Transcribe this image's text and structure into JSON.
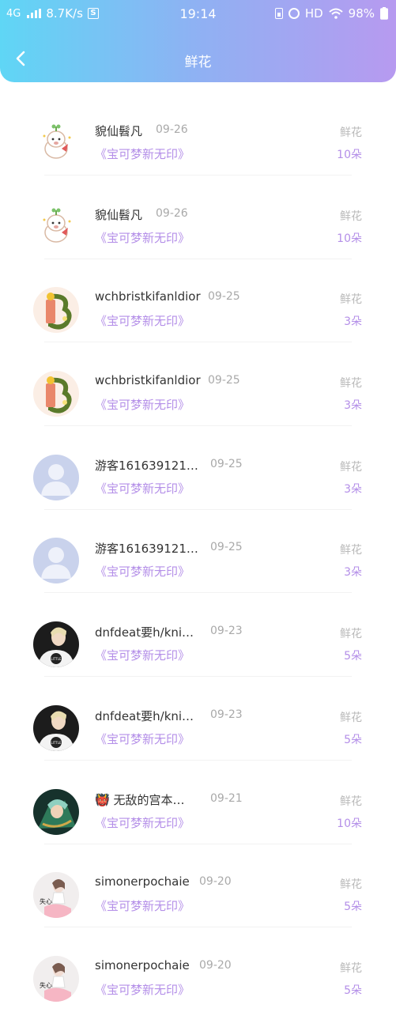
{
  "status": {
    "network": "4G",
    "speed": "8.7K/s",
    "time": "19:14",
    "hd": "HD",
    "battery": "98%"
  },
  "nav": {
    "title": "鲜花"
  },
  "rows": [
    {
      "name": "貌仙髫凡",
      "date": "09-26",
      "origin": "《宝可梦新无印》",
      "label": "鲜花",
      "count": "10朵",
      "avatar": "cartoon-bear-avatar"
    },
    {
      "name": "貌仙髫凡",
      "date": "09-26",
      "origin": "《宝可梦新无印》",
      "label": "鲜花",
      "count": "10朵",
      "avatar": "cartoon-bear-avatar"
    },
    {
      "name": "wchbristkifanldior",
      "date": "09-25",
      "origin": "《宝可梦新无印》",
      "label": "鲜花",
      "count": "3朵",
      "avatar": "letter-b-avatar"
    },
    {
      "name": "wchbristkifanldior",
      "date": "09-25",
      "origin": "《宝可梦新无印》",
      "label": "鲜花",
      "count": "3朵",
      "avatar": "letter-b-avatar"
    },
    {
      "name": "游客161639121…",
      "date": "09-25",
      "origin": "《宝可梦新无印》",
      "label": "鲜花",
      "count": "3朵",
      "avatar": "default-user-avatar"
    },
    {
      "name": "游客161639121…",
      "date": "09-25",
      "origin": "《宝可梦新无印》",
      "label": "鲜花",
      "count": "3朵",
      "avatar": "default-user-avatar"
    },
    {
      "name": "dnfdeat要h/kni…",
      "date": "09-23",
      "origin": "《宝可梦新无印》",
      "label": "鲜花",
      "count": "5朵",
      "avatar": "person-photo-avatar"
    },
    {
      "name": "dnfdeat要h/kni…",
      "date": "09-23",
      "origin": "《宝可梦新无印》",
      "label": "鲜花",
      "count": "5朵",
      "avatar": "person-photo-avatar"
    },
    {
      "name": "👹 无敌的宫本…",
      "date": "09-21",
      "origin": "《宝可梦新无印》",
      "label": "鲜花",
      "count": "10朵",
      "avatar": "game-character-avatar"
    },
    {
      "name": "simonerpochaie",
      "date": "09-20",
      "origin": "《宝可梦新无印》",
      "label": "鲜花",
      "count": "5朵",
      "avatar": "girl-illustration-avatar"
    },
    {
      "name": "simonerpochaie",
      "date": "09-20",
      "origin": "《宝可梦新无印》",
      "label": "鲜花",
      "count": "5朵",
      "avatar": "girl-illustration-avatar"
    }
  ]
}
